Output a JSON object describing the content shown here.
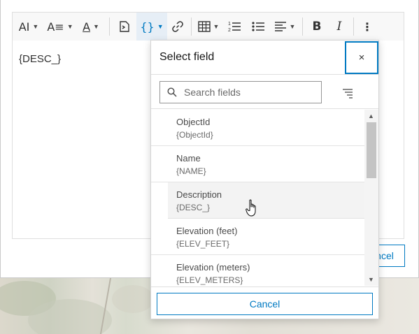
{
  "toolbar": {
    "buttons": [
      {
        "icon": "font-size-icon",
        "glyph": "AI"
      },
      {
        "icon": "text-style-icon",
        "glyph": "A≡"
      },
      {
        "icon": "font-color-icon",
        "glyph": "A"
      },
      {
        "icon": "insert-expression-icon",
        "glyph": "⮳"
      },
      {
        "icon": "insert-field-icon",
        "glyph": "{}"
      },
      {
        "icon": "link-icon",
        "glyph": "⛓"
      },
      {
        "icon": "table-icon",
        "glyph": "⊞"
      },
      {
        "icon": "numbered-list-icon",
        "glyph": "☰"
      },
      {
        "icon": "bulleted-list-icon",
        "glyph": "☰"
      },
      {
        "icon": "align-icon",
        "glyph": "≡"
      },
      {
        "icon": "bold-icon",
        "glyph": "B"
      },
      {
        "icon": "italic-icon",
        "glyph": "I"
      },
      {
        "icon": "more-options-icon",
        "glyph": "⋮"
      }
    ]
  },
  "editor": {
    "content": "{DESC_}"
  },
  "background_cancel": {
    "label": "ncel"
  },
  "popover": {
    "title": "Select field",
    "close_glyph": "×",
    "search": {
      "placeholder": "Search fields",
      "value": ""
    },
    "fields": [
      {
        "name": "ObjectId",
        "code": "{ObjectId}"
      },
      {
        "name": "Name",
        "code": "{NAME}"
      },
      {
        "name": "Description",
        "code": "{DESC_}"
      },
      {
        "name": "Elevation (feet)",
        "code": "{ELEV_FEET}"
      },
      {
        "name": "Elevation (meters)",
        "code": "{ELEV_METERS}"
      }
    ],
    "cancel_label": "Cancel"
  },
  "colors": {
    "accent": "#007ac2",
    "text": "#323232",
    "hover": "#f3f3f3"
  }
}
